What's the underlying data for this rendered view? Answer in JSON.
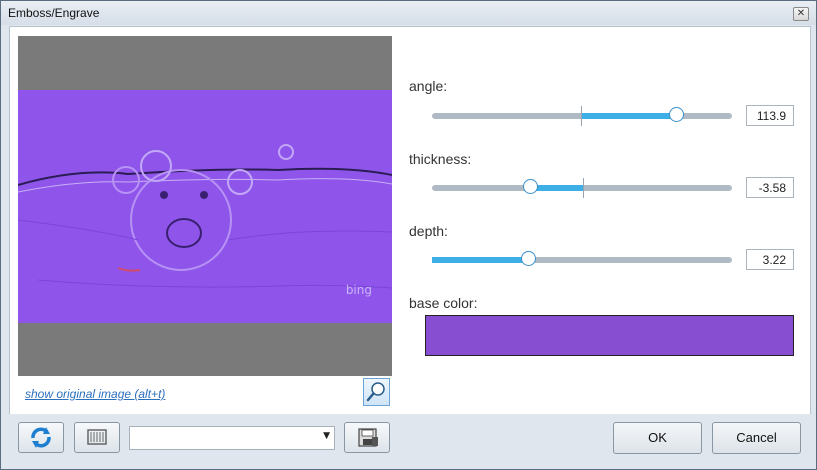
{
  "window": {
    "title": "Emboss/Engrave",
    "close_glyph": "✕"
  },
  "preview": {
    "watermark": "bing",
    "show_original_link": "show original image (alt+t)"
  },
  "params": {
    "angle": {
      "label": "angle:",
      "value": "113.9"
    },
    "thickness": {
      "label": "thickness:",
      "value": "-3.58"
    },
    "depth": {
      "label": "depth:",
      "value": "3.22"
    },
    "base_color": {
      "label": "base color:",
      "color": "#884ed1"
    }
  },
  "toolbar": {
    "preset_value": "",
    "dropdown_arrow": "▼"
  },
  "buttons": {
    "ok": "OK",
    "cancel": "Cancel"
  },
  "icons": {
    "refresh": "refresh-icon",
    "pattern": "pattern-icon",
    "save": "save-icon",
    "zoom": "zoom-icon"
  },
  "colors": {
    "accent": "#3eaee6",
    "preview_tint": "#8f55ea"
  }
}
